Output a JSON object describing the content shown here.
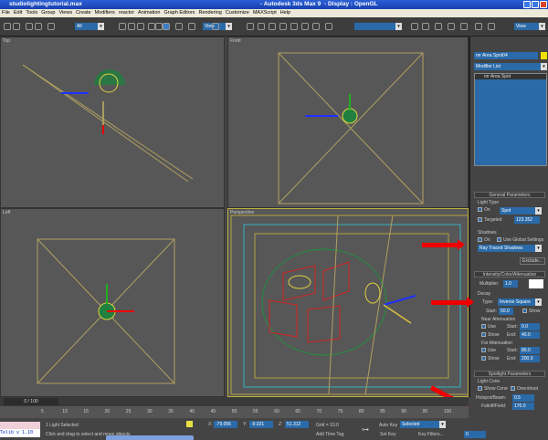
{
  "window": {
    "file": "studiolightingtutorial.max",
    "app": "- Autodesk 3ds Max 9",
    "display": "- Display : OpenGL"
  },
  "menu": [
    "File",
    "Edit",
    "Tools",
    "Group",
    "Views",
    "Create",
    "Modifiers",
    "reactor",
    "Animation",
    "Graph Editors",
    "Rendering",
    "Customize",
    "MAXScript",
    "Help"
  ],
  "toolbar": {
    "selection_filter": "All",
    "ref_coord": "View",
    "named_sel": "",
    "ref_coord2": "View"
  },
  "viewports": {
    "top": "Top",
    "front": "Front",
    "left": "Left",
    "perspective": "Perspective"
  },
  "command_panel": {
    "object_name": "mr Area Spot04",
    "object_color": "#f0e000",
    "modifier_list": "Modifier List",
    "stack_item": "mr Area Spot",
    "general": {
      "title": "General Parameters",
      "light_type": "Light Type",
      "on": "On",
      "type": "Spot",
      "targeted": "Targeted",
      "target_dist": "123.352",
      "shadows": "Shadows",
      "shadow_on": "On",
      "use_global": "Use Global Settings",
      "shadow_type": "Ray Traced Shadows",
      "exclude": "Exclude..."
    },
    "intensity": {
      "title": "Intensity/Color/Attenuation",
      "multiplier_label": "Multiplier:",
      "multiplier": "1.0",
      "decay": "Decay",
      "type_label": "Type:",
      "decay_type": "Inverse Square",
      "start_label": "Start:",
      "start": "50.0",
      "show": "Show",
      "near": "Near Attenuation",
      "use": "Use",
      "near_start": "0.0",
      "end_label": "End:",
      "near_end": "40.0",
      "far": "Far Attenuation",
      "far_start": "80.0",
      "far_end": "200.0"
    },
    "spotlight": {
      "title": "Spotlight Parameters",
      "light_cone": "Light Cone",
      "show_cone": "Show Cone",
      "overshoot": "Overshoot",
      "hotspot_label": "Hotspot/Beam:",
      "hotspot": "0.5",
      "falloff_label": "Falloff/Field:",
      "falloff": "170.0"
    }
  },
  "timeline": {
    "slider": "0 / 100",
    "ticks": [
      "5",
      "10",
      "15",
      "20",
      "25",
      "30",
      "35",
      "40",
      "45",
      "50",
      "55",
      "60",
      "65",
      "70",
      "75",
      "80",
      "85",
      "90",
      "95",
      "100"
    ]
  },
  "status": {
    "maxscript": "Telib v 1.10",
    "selection": "1 Light Selected",
    "prompt": "Click and drag to select and move objects",
    "x": "-79.056",
    "y": "-9.021",
    "z": "51.312",
    "grid": "Grid = 10.0",
    "add_time_tag": "Add Time Tag",
    "auto_key": "Auto Key",
    "key_mode": "Selected",
    "set_key": "Set Key",
    "key_filters": "Key Filters...",
    "frame": "0"
  },
  "annotation_color": "#e00000"
}
